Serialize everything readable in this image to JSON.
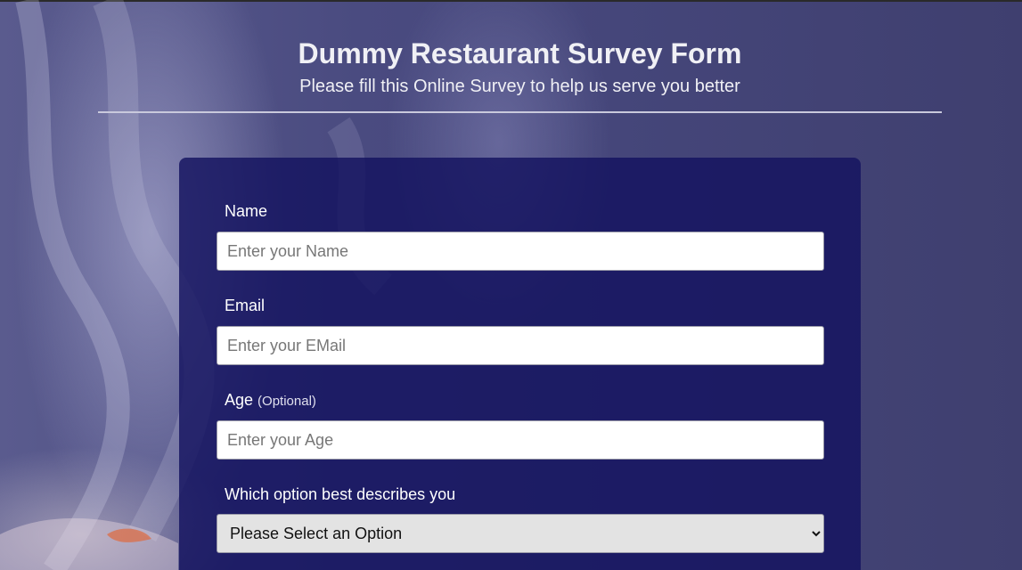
{
  "header": {
    "title": "Dummy Restaurant Survey Form",
    "subtitle": "Please fill this Online Survey to help us serve you better"
  },
  "form": {
    "name": {
      "label": "Name",
      "placeholder": "Enter your Name"
    },
    "email": {
      "label": "Email",
      "placeholder": "Enter your EMail"
    },
    "age": {
      "label": "Age",
      "optional_note": "(Optional)",
      "placeholder": "Enter your Age"
    },
    "describe": {
      "label": "Which option best describes you",
      "selected": "Please Select an Option"
    }
  }
}
